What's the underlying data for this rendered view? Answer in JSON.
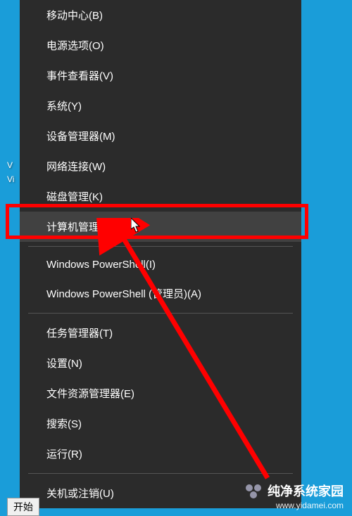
{
  "desktop": {
    "icon_text_1": "V",
    "icon_text_2": "Vi"
  },
  "menu": {
    "items": [
      {
        "label": "移动中心(B)",
        "group": 0
      },
      {
        "label": "电源选项(O)",
        "group": 0
      },
      {
        "label": "事件查看器(V)",
        "group": 0
      },
      {
        "label": "系统(Y)",
        "group": 0
      },
      {
        "label": "设备管理器(M)",
        "group": 0
      },
      {
        "label": "网络连接(W)",
        "group": 0
      },
      {
        "label": "磁盘管理(K)",
        "group": 0
      },
      {
        "label": "计算机管理(G)",
        "group": 0,
        "highlighted": true
      },
      {
        "label": "Windows PowerShell(I)",
        "group": 1
      },
      {
        "label": "Windows PowerShell (管理员)(A)",
        "group": 1
      },
      {
        "label": "任务管理器(T)",
        "group": 2
      },
      {
        "label": "设置(N)",
        "group": 2
      },
      {
        "label": "文件资源管理器(E)",
        "group": 2
      },
      {
        "label": "搜索(S)",
        "group": 2
      },
      {
        "label": "运行(R)",
        "group": 2
      },
      {
        "label": "关机或注销(U)",
        "group": 3
      }
    ]
  },
  "start_label": "开始",
  "watermark": {
    "brand": "纯净系统家园",
    "url": "www.yidamei.com"
  },
  "highlight": {
    "target_index": 7,
    "color": "#ff0000"
  }
}
